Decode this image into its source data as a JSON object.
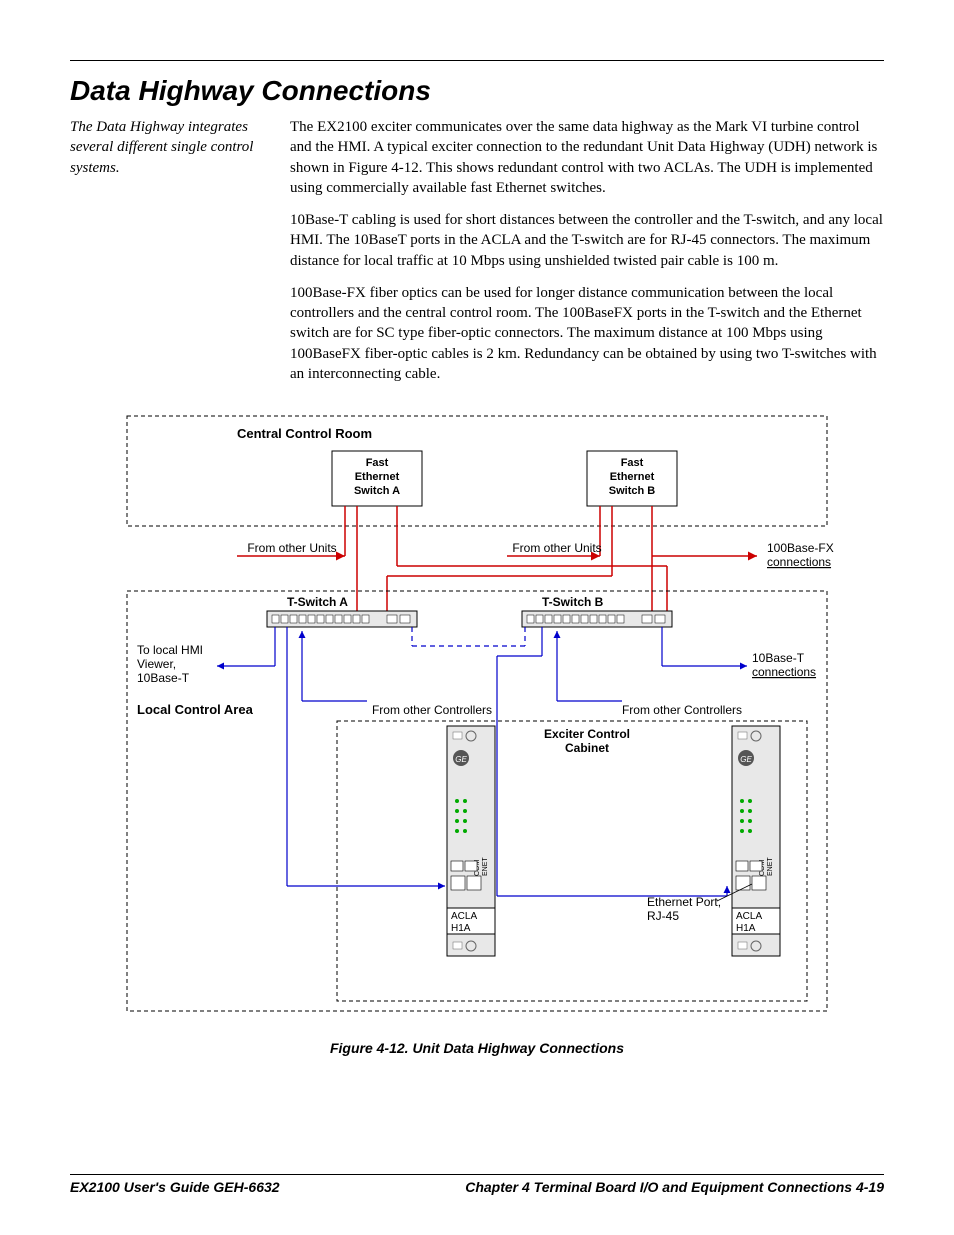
{
  "heading": "Data Highway Connections",
  "sidebar_note": "The Data Highway integrates several different single control systems.",
  "para1": "The EX2100 exciter communicates over the same data highway as the Mark VI turbine control and the HMI. A typical exciter connection to the redundant Unit Data Highway (UDH) network is shown in Figure 4-12. This shows redundant control with two ACLAs. The UDH is implemented using commercially available fast Ethernet switches.",
  "para2": "10Base-T cabling is used for short distances between the controller and the T-switch, and any local HMI. The 10BaseT ports in the ACLA and the T-switch are for RJ-45 connectors. The maximum distance for local traffic at 10 Mbps using unshielded twisted pair cable is 100 m.",
  "para3": "100Base-FX fiber optics can be used for longer distance communication between the local controllers and the central control room. The 100BaseFX ports in the T-switch and the Ethernet switch are for SC type fiber-optic connectors. The maximum distance at 100 Mbps using 100BaseFX fiber-optic cables is 2 km. Redundancy can be obtained by using two T-switches with an interconnecting cable.",
  "caption": "Figure 4-12.  Unit Data Highway Connections",
  "footer_left": "EX2100 User's Guide  GEH-6632",
  "footer_right": "Chapter 4 Terminal Board I/O and Equipment Connections    4-19",
  "diagram": {
    "central_room": "Central Control Room",
    "switch_a": "Fast\nEthernet\nSwitch A",
    "switch_b": "Fast\nEthernet\nSwitch B",
    "from_other_units": "From other Units",
    "fx_conn": "100Base-FX\nconnections",
    "tswitch_a": "T-Switch A",
    "tswitch_b": "T-Switch B",
    "to_hmi": "To local HMI\nViewer,\n10Base-T",
    "tenbase_conn": "10Base-T\nconnections",
    "local_area": "Local Control Area",
    "from_ctrl": "From other Controllers",
    "exciter": "Exciter Control\nCabinet",
    "enet_port": "Ethernet Port,\nRJ-45",
    "acla": "ACLA",
    "h1a": "H1A",
    "com": "COM",
    "enet": "ENET"
  }
}
